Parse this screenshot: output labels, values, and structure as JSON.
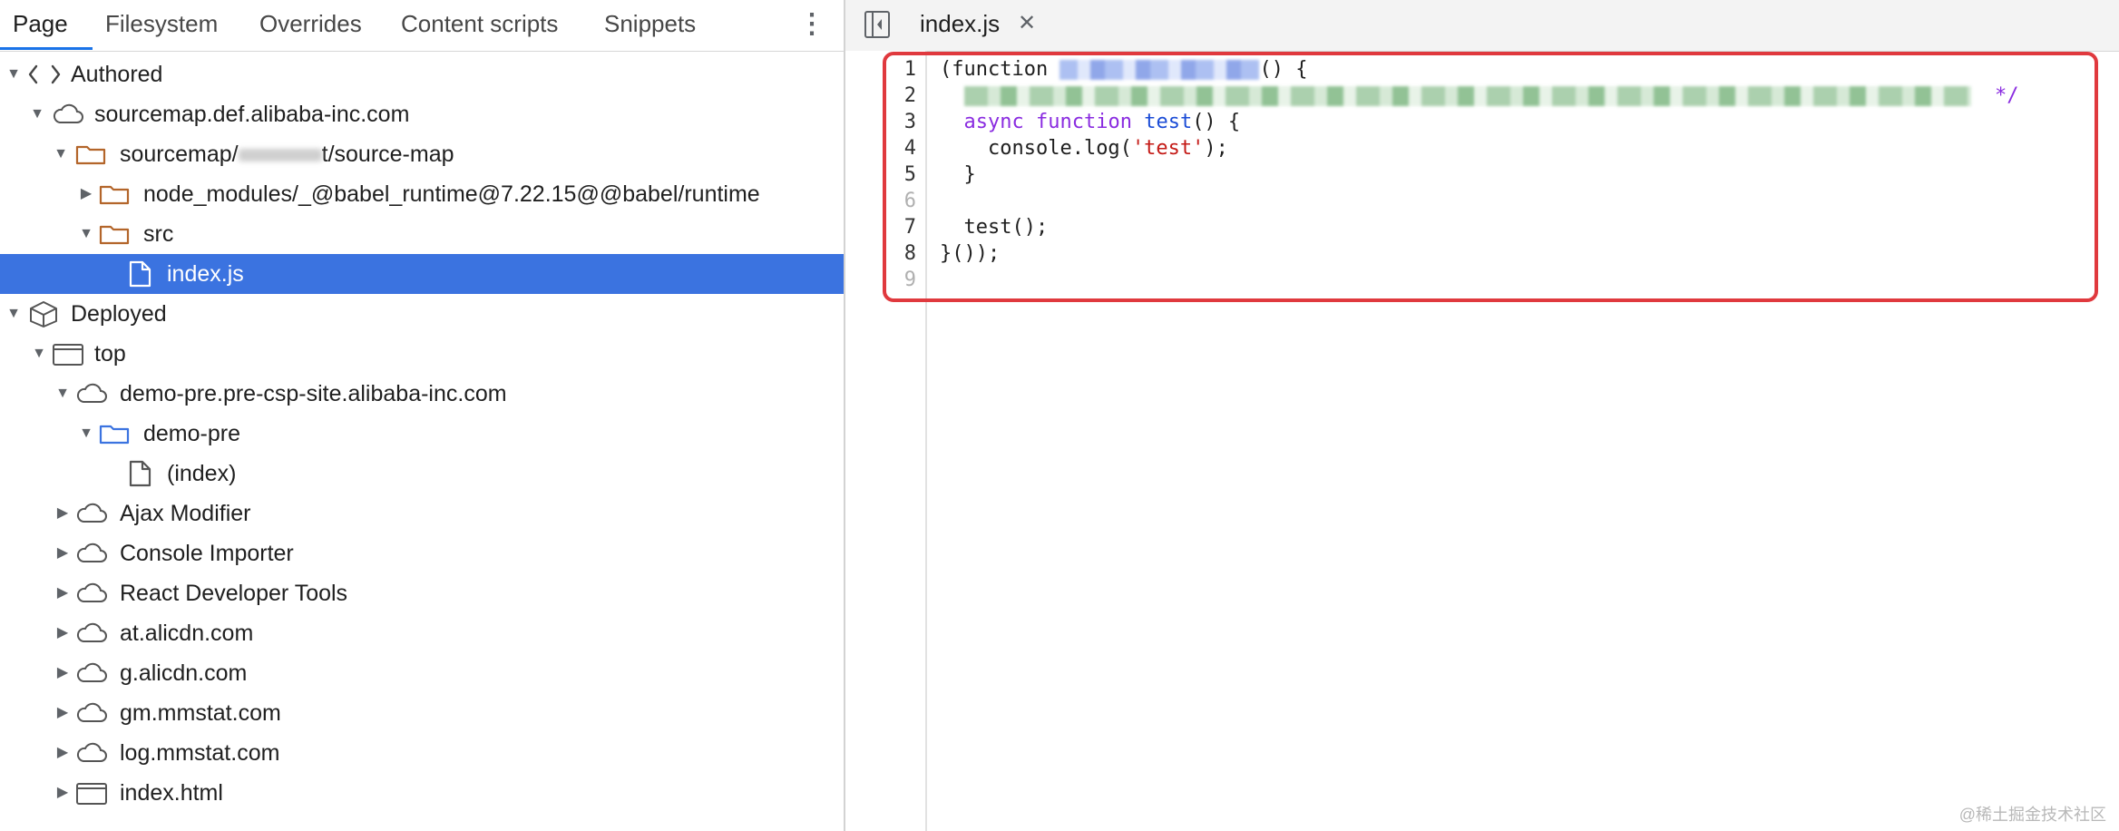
{
  "left_panel": {
    "tabs": [
      "Page",
      "Filesystem",
      "Overrides",
      "Content scripts",
      "Snippets"
    ],
    "active_tab": "Page",
    "more_icon": "⋮",
    "tree": [
      {
        "label": "Authored",
        "icon": "code-brackets-icon",
        "expanded": true
      },
      {
        "label": "sourcemap.def.alibaba-inc.com",
        "icon": "cloud-icon",
        "expanded": true
      },
      {
        "label_before": "sourcemap/",
        "label_after": "t/source-map",
        "icon": "folder-icon",
        "expanded": true,
        "redacted": true
      },
      {
        "label": "node_modules/_@babel_runtime@7.22.15@@babel/runtime",
        "icon": "folder-icon",
        "expanded": false
      },
      {
        "label": "src",
        "icon": "folder-icon",
        "expanded": true
      },
      {
        "label": "index.js",
        "icon": "file-icon",
        "selected": true
      },
      {
        "label": "Deployed",
        "icon": "cube-icon",
        "expanded": true
      },
      {
        "label": "top",
        "icon": "frame-icon",
        "expanded": true
      },
      {
        "label": "demo-pre.pre-csp-site.alibaba-inc.com",
        "icon": "cloud-icon",
        "expanded": true
      },
      {
        "label": "demo-pre",
        "icon": "folder-icon",
        "expanded": true
      },
      {
        "label": "(index)",
        "icon": "file-icon"
      },
      {
        "label": "Ajax Modifier",
        "icon": "cloud-icon",
        "expanded": false
      },
      {
        "label": "Console Importer",
        "icon": "cloud-icon",
        "expanded": false
      },
      {
        "label": "React Developer Tools",
        "icon": "cloud-icon",
        "expanded": false
      },
      {
        "label": "at.alicdn.com",
        "icon": "cloud-icon",
        "expanded": false
      },
      {
        "label": "g.alicdn.com",
        "icon": "cloud-icon",
        "expanded": false
      },
      {
        "label": "gm.mmstat.com",
        "icon": "cloud-icon",
        "expanded": false
      },
      {
        "label": "log.mmstat.com",
        "icon": "cloud-icon",
        "expanded": false
      },
      {
        "label": "index.html",
        "icon": "frame-icon",
        "expanded": false
      }
    ]
  },
  "editor": {
    "file_tab": "index.js",
    "close_glyph": "✕",
    "line_numbers": [
      "1",
      "2",
      "3",
      "4",
      "5",
      "6",
      "7",
      "8",
      "9"
    ],
    "code": {
      "l1_open": "(function ",
      "l1_close": "() {",
      "l2_end": "*/",
      "l3_async": "async",
      "l3_function": "function",
      "l3_name": "test",
      "l3_rest": "() {",
      "l4_pre": "console.log(",
      "l4_str": "'test'",
      "l4_post": ");",
      "l5": "}",
      "l7": "test();",
      "l8": "}());"
    }
  },
  "watermark": "@稀土掘金技术社区",
  "colors": {
    "selection": "#3b73e0",
    "keyword": "#8a2ce0",
    "string": "#c41a16",
    "highlight_box": "#e0393e",
    "tab_underline": "#1a73e8"
  }
}
